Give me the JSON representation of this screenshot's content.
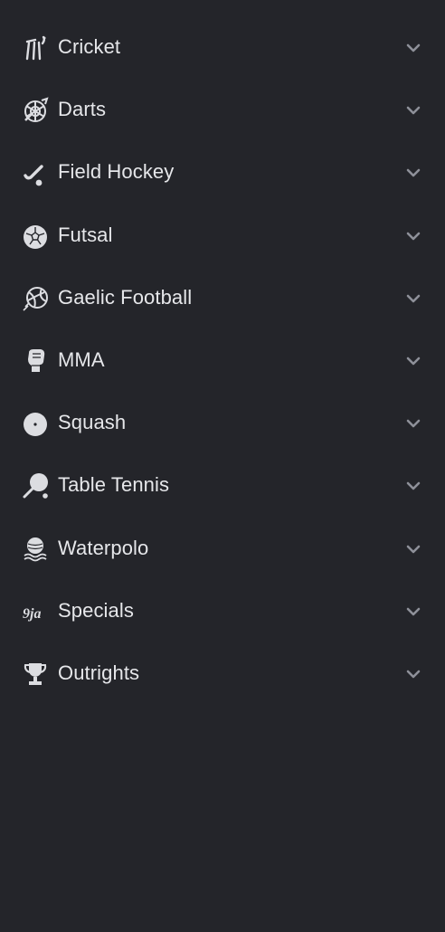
{
  "sports_menu": {
    "items": [
      {
        "label": "Cricket",
        "icon": "cricket-stumps-icon"
      },
      {
        "label": "Darts",
        "icon": "dartboard-icon"
      },
      {
        "label": "Field Hockey",
        "icon": "hockey-stick-icon"
      },
      {
        "label": "Futsal",
        "icon": "futsal-ball-icon"
      },
      {
        "label": "Gaelic Football",
        "icon": "gaelic-ball-icon"
      },
      {
        "label": "MMA",
        "icon": "mma-glove-icon"
      },
      {
        "label": "Squash",
        "icon": "squash-ball-icon"
      },
      {
        "label": "Table Tennis",
        "icon": "table-tennis-paddle-icon"
      },
      {
        "label": "Waterpolo",
        "icon": "waterpolo-ball-icon"
      },
      {
        "label": "Specials",
        "icon": "9ja-logo-icon",
        "icon_text": "9ja"
      },
      {
        "label": "Outrights",
        "icon": "trophy-icon"
      }
    ]
  },
  "colors": {
    "background": "#24252a",
    "text": "#e6e7ea",
    "icon": "#dcdde1",
    "chevron": "#8e9099"
  }
}
